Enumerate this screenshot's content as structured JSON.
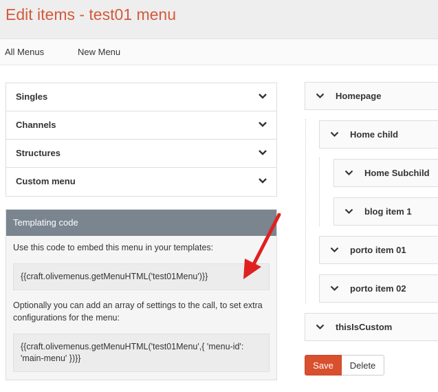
{
  "header": {
    "title": "Edit items - test01 menu"
  },
  "subnav": {
    "all_menus": "All Menus",
    "new_menu": "New Menu"
  },
  "sources": {
    "items": [
      {
        "label": "Singles"
      },
      {
        "label": "Channels"
      },
      {
        "label": "Structures"
      },
      {
        "label": "Custom menu"
      }
    ]
  },
  "templating": {
    "title": "Templating code",
    "intro": "Use this code to embed this menu in your templates:",
    "code1": "{{craft.olivemenus.getMenuHTML('test01Menu')}}",
    "optional": "Optionally you can add an array of settings to the call, to set extra configurations for the menu:",
    "code2": "{{craft.olivemenus.getMenuHTML('test01Menu',{ 'menu-id': 'main-menu' })}}"
  },
  "tree": [
    {
      "label": "Homepage"
    },
    {
      "label": "Home child"
    },
    {
      "label": "Home Subchild"
    },
    {
      "label": "blog item 1"
    },
    {
      "label": "porto item 01"
    },
    {
      "label": "porto item 02"
    },
    {
      "label": "thisIsCustom"
    }
  ],
  "actions": {
    "save": "Save",
    "delete": "Delete"
  },
  "colors": {
    "accent": "#d35a3a",
    "panel_header": "#7a8590",
    "save_button": "#d9502f"
  },
  "icons": {
    "chevron": "chevron-down-icon",
    "arrow": "red-arrow-annotation"
  }
}
